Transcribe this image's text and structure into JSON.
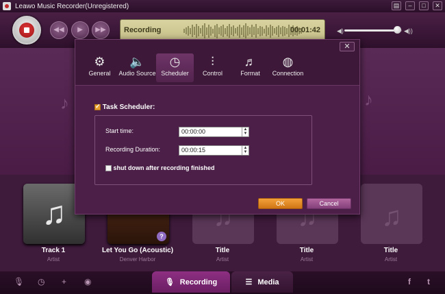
{
  "window": {
    "title": "Leawo Music Recorder(Unregistered)",
    "controls": [
      "menu-icon",
      "minimize-icon",
      "restore-icon",
      "close-icon"
    ]
  },
  "player": {
    "status": "Recording",
    "time": "00:01:42",
    "volume_fraction": 0.92
  },
  "dialog": {
    "tabs": [
      {
        "label": "General",
        "icon": "gear-icon"
      },
      {
        "label": "Audio Source",
        "icon": "speaker-icon"
      },
      {
        "label": "Scheduler",
        "icon": "clock-icon"
      },
      {
        "label": "Control",
        "icon": "sliders-icon"
      },
      {
        "label": "Format",
        "icon": "music-file-icon"
      },
      {
        "label": "Connection",
        "icon": "globe-icon"
      }
    ],
    "active_tab": "Scheduler",
    "task_scheduler_label": "Task Scheduler:",
    "task_scheduler_checked": true,
    "start_time_label": "Start time:",
    "start_time_value": "00:00:00",
    "duration_label": "Recording Duration:",
    "duration_value": "00:00:15",
    "shutdown_label": "shut down after recording finished",
    "shutdown_checked": false,
    "ok_label": "OK",
    "cancel_label": "Cancel"
  },
  "tracks": [
    {
      "title": "Track 1",
      "artist": "Artist"
    },
    {
      "title": "Let You Go (Acoustic)",
      "artist": "Denver Harbor"
    },
    {
      "title": "Title",
      "artist": "Artist"
    },
    {
      "title": "Title",
      "artist": "Artist"
    },
    {
      "title": "Title",
      "artist": "Artist"
    }
  ],
  "bottom": {
    "recording_tab": "Recording",
    "media_tab": "Media"
  },
  "colors": {
    "accent_orange": "#e8a030",
    "active_tab": "#8e2f83",
    "background": "#4a1c46"
  }
}
